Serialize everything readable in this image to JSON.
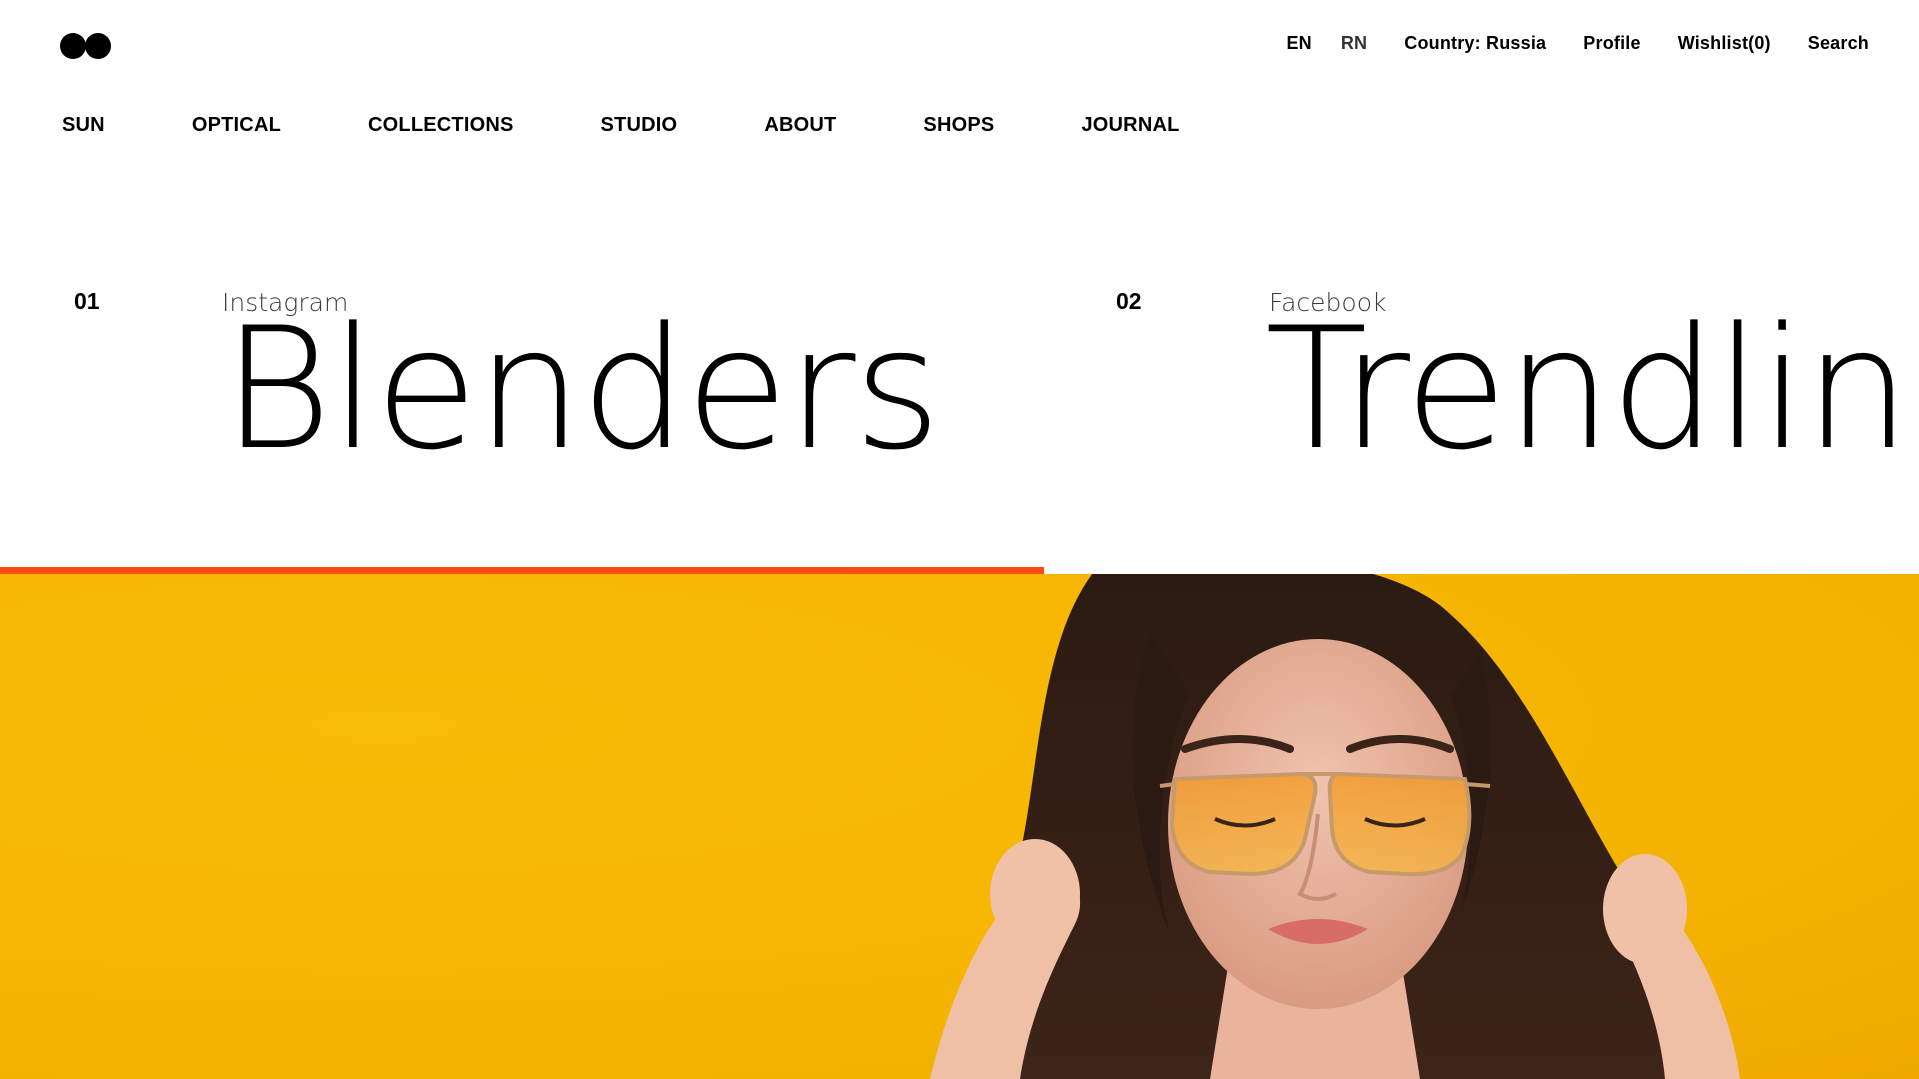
{
  "header": {
    "logo": "logo-two-dots",
    "languages": [
      "EN",
      "RN"
    ],
    "country": "Country: Russia",
    "profile": "Profile",
    "wishlist": "Wishlist(0)",
    "search": "Search"
  },
  "nav": {
    "items": [
      "SUN",
      "OPTICAL",
      "COLLECTIONS",
      "STUDIO",
      "ABOUT",
      "SHOPS",
      "JOURNAL"
    ]
  },
  "slider": {
    "slides": [
      {
        "number": "01",
        "source": "Instagram",
        "title": "Blenders"
      },
      {
        "number": "02",
        "source": "Facebook",
        "title": "Trendline"
      }
    ],
    "progress_percent": 54.4
  },
  "hero": {
    "background_color": "#f7b500",
    "accent_color": "#ff4a0f",
    "image": "woman-in-orange-tinted-glasses"
  }
}
